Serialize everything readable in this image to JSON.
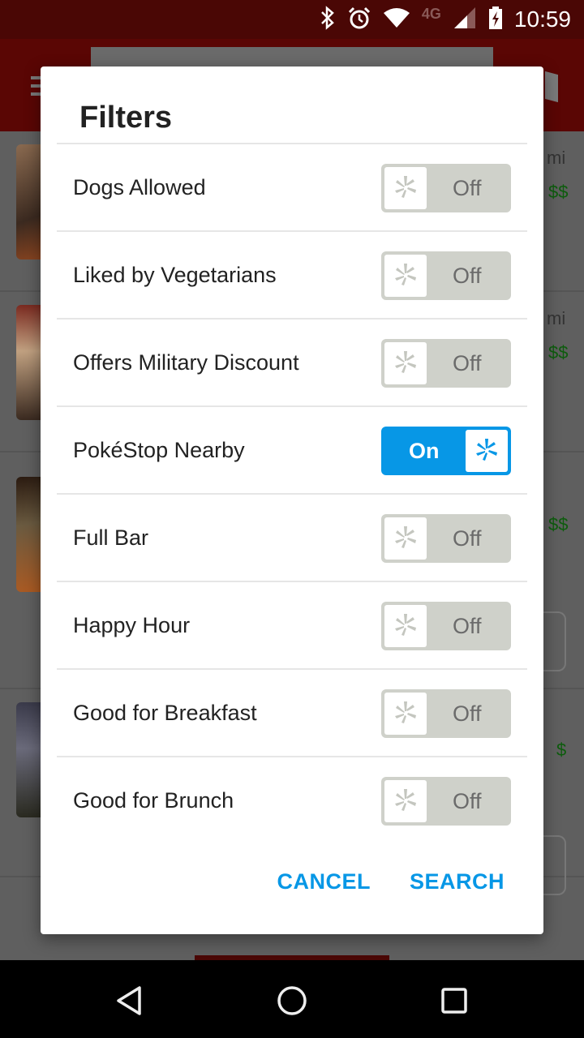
{
  "status_bar": {
    "time": "10:59",
    "network_label": "4G",
    "icons": [
      "bluetooth-icon",
      "alarm-icon",
      "wifi-icon",
      "4g-lte-icon",
      "cell-signal-icon",
      "battery-charging-icon"
    ]
  },
  "background_list": {
    "items": [
      {
        "distance": "mi",
        "price": "$$"
      },
      {
        "distance": "mi",
        "price": "$$"
      },
      {
        "distance": "",
        "price": "$$"
      },
      {
        "distance": "",
        "price": "$"
      }
    ]
  },
  "dialog": {
    "title": "Filters",
    "filters": [
      {
        "label": "Dogs Allowed",
        "state": "Off",
        "on": false
      },
      {
        "label": "Liked by Vegetarians",
        "state": "Off",
        "on": false
      },
      {
        "label": "Offers Military Discount",
        "state": "Off",
        "on": false
      },
      {
        "label": "PokéStop Nearby",
        "state": "On",
        "on": true
      },
      {
        "label": "Full Bar",
        "state": "Off",
        "on": false
      },
      {
        "label": "Happy Hour",
        "state": "Off",
        "on": false
      },
      {
        "label": "Good for Breakfast",
        "state": "Off",
        "on": false
      },
      {
        "label": "Good for Brunch",
        "state": "Off",
        "on": false
      }
    ],
    "cancel_label": "CANCEL",
    "search_label": "SEARCH"
  },
  "colors": {
    "accent": "#0797e6",
    "toggle_off": "#cfd1ca",
    "brand_red": "#5a0604",
    "price_green": "#0d5c0d"
  },
  "nav_bar": {
    "buttons": [
      "back",
      "home",
      "recents"
    ]
  }
}
